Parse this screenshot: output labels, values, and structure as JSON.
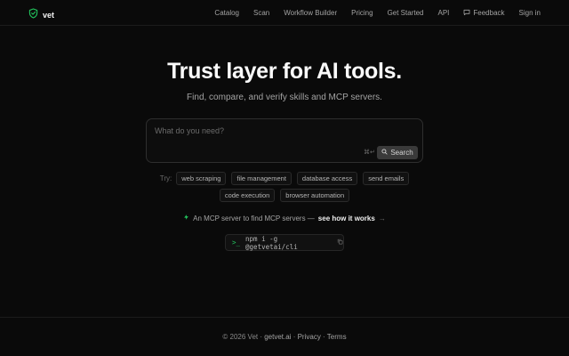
{
  "nav": {
    "brand": "vet",
    "links": [
      {
        "label": "Catalog"
      },
      {
        "label": "Scan"
      },
      {
        "label": "Workflow Builder"
      },
      {
        "label": "Pricing"
      },
      {
        "label": "Get Started"
      },
      {
        "label": "API"
      },
      {
        "label": "Feedback",
        "icon": "message-square-icon"
      },
      {
        "label": "Sign in"
      }
    ]
  },
  "hero": {
    "title": "Trust layer for AI tools.",
    "subtitle": "Find, compare, and verify skills and MCP servers."
  },
  "search": {
    "placeholder": "What do you need?",
    "shortcut": "⌘↵",
    "button_label": "Search"
  },
  "suggestions": {
    "label": "Try:",
    "chips": [
      "web scraping",
      "file management",
      "database access",
      "send emails",
      "code execution",
      "browser automation"
    ]
  },
  "mcp": {
    "text": "An MCP server to find MCP servers —",
    "link": "see how it works",
    "arrow": "→"
  },
  "cli": {
    "prompt": ">_",
    "command": "npm i -g @getvetai/cli"
  },
  "footer": {
    "copyright": "© 2026 Vet ·",
    "site": "getvet.ai",
    "sep1": " · ",
    "privacy": "Privacy",
    "sep2": " · ",
    "terms": "Terms"
  },
  "colors": {
    "background": "#0a0a0a",
    "accent": "#22c55e"
  }
}
